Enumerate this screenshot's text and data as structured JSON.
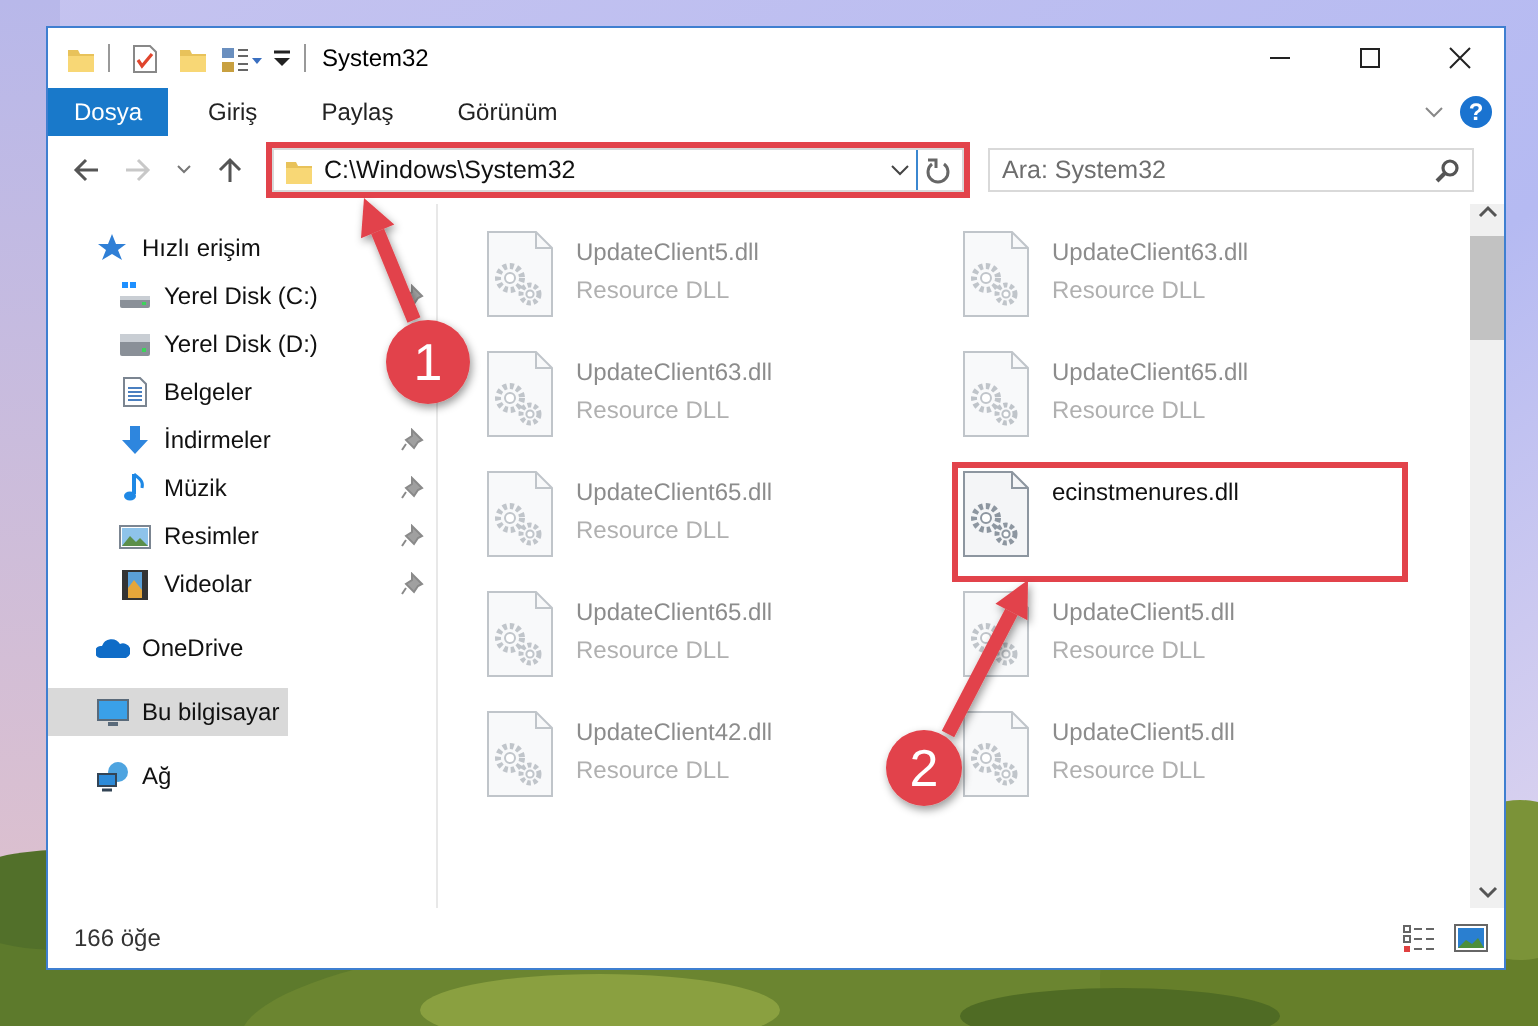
{
  "window": {
    "title": "System32"
  },
  "ribbon": {
    "tabs": [
      {
        "label": "Dosya",
        "selected": true
      },
      {
        "label": "Giriş",
        "selected": false
      },
      {
        "label": "Paylaş",
        "selected": false
      },
      {
        "label": "Görünüm",
        "selected": false
      }
    ],
    "help": "?"
  },
  "address_bar": {
    "path": "C:\\Windows\\System32",
    "highlighted": true
  },
  "search": {
    "placeholder": "Ara: System32"
  },
  "nav_pane": {
    "items": [
      {
        "label": "Hızlı erişim",
        "kind": "star",
        "selected": false,
        "children": [
          {
            "label": "Yerel Disk (C:)",
            "kind": "windrive",
            "pinned": true,
            "selected": false
          },
          {
            "label": "Yerel Disk (D:)",
            "kind": "drive",
            "pinned": false,
            "selected": false
          },
          {
            "label": "Belgeler",
            "kind": "document",
            "pinned": false,
            "selected": false
          },
          {
            "label": "İndirmeler",
            "kind": "download",
            "pinned": true,
            "selected": false
          },
          {
            "label": "Müzik",
            "kind": "music",
            "pinned": true,
            "selected": false
          },
          {
            "label": "Resimler",
            "kind": "pictures",
            "pinned": true,
            "selected": false
          },
          {
            "label": "Videolar",
            "kind": "videos",
            "pinned": true,
            "selected": false
          }
        ]
      },
      {
        "label": "OneDrive",
        "kind": "cloud",
        "selected": false
      },
      {
        "label": "Bu bilgisayar",
        "kind": "computer",
        "selected": true
      },
      {
        "label": "Ağ",
        "kind": "network",
        "selected": false
      }
    ]
  },
  "files": [
    {
      "name": "UpdateClient5.dll",
      "type": "Resource DLL",
      "blurred": true,
      "highlighted": false
    },
    {
      "name": "UpdateClient63.dll",
      "type": "Resource DLL",
      "blurred": true,
      "highlighted": false
    },
    {
      "name": "UpdateClient63.dll",
      "type": "Resource DLL",
      "blurred": true,
      "highlighted": false
    },
    {
      "name": "UpdateClient65.dll",
      "type": "Resource DLL",
      "blurred": true,
      "highlighted": false
    },
    {
      "name": "UpdateClient65.dll",
      "type": "Resource DLL",
      "blurred": true,
      "highlighted": false
    },
    {
      "name": "ecinstmenures.dll",
      "blurred": false,
      "highlighted": true
    },
    {
      "name": "UpdateClient65.dll",
      "type": "Resource DLL",
      "blurred": true,
      "highlighted": false
    },
    {
      "name": "UpdateClient5.dll",
      "type": "Resource DLL",
      "blurred": true,
      "highlighted": false
    },
    {
      "name": "UpdateClient42.dll",
      "type": "Resource DLL",
      "blurred": true,
      "highlighted": false
    },
    {
      "name": "UpdateClient5.dll",
      "type": "Resource DLL",
      "blurred": true,
      "highlighted": false
    }
  ],
  "status_bar": {
    "item_count": "166 öğe"
  },
  "callouts": [
    {
      "number": "1"
    },
    {
      "number": "2"
    }
  ]
}
